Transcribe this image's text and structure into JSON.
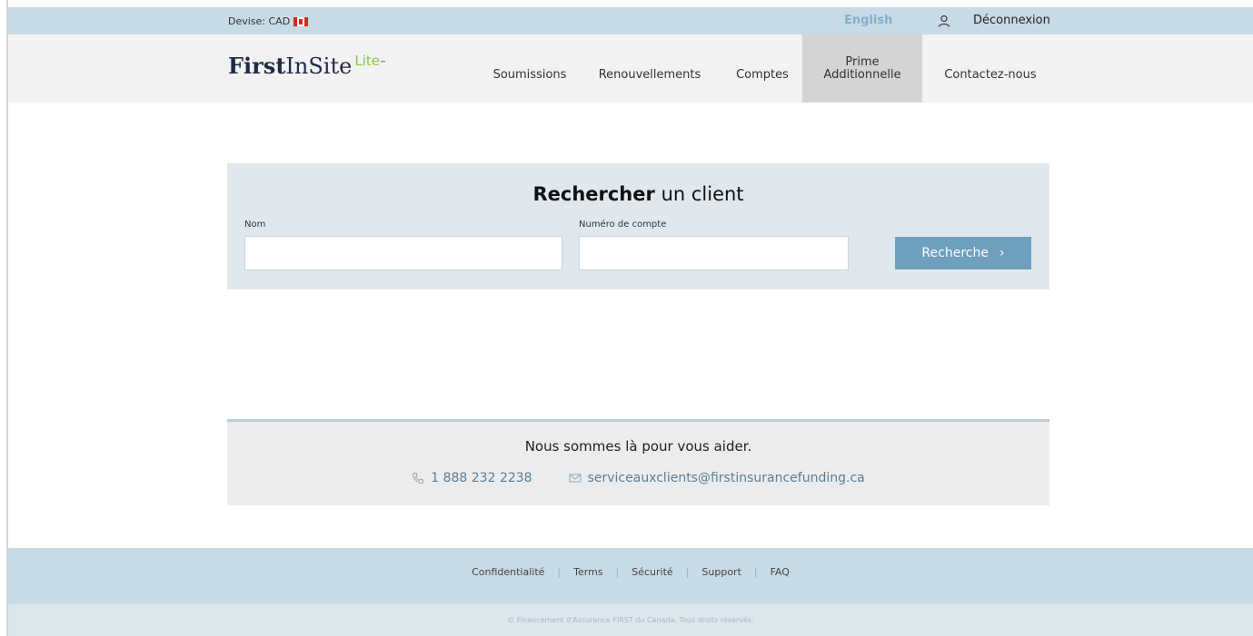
{
  "topbar": {
    "currency": "Devise: CAD",
    "language_link": "English",
    "logout": "Déconnexion"
  },
  "brand": {
    "first": "First",
    "insite": "InSite",
    "lite": "Lite",
    "tm": "™"
  },
  "nav": {
    "items": [
      {
        "label": "Soumissions"
      },
      {
        "label": "Renouvellements"
      },
      {
        "label": "Comptes"
      },
      {
        "label_line1": "Prime",
        "label_line2": "Additionnelle",
        "active": true
      },
      {
        "label": "Contactez-nous"
      }
    ]
  },
  "search": {
    "title_bold": "Rechercher",
    "title_rest": "un client",
    "name_label": "Nom",
    "name_value": "",
    "account_label": "Numéro de compte",
    "account_value": "",
    "button_label": "Recherche",
    "button_arrow": "›"
  },
  "help": {
    "title": "Nous sommes là pour vous aider.",
    "phone": "1 888 232 2238",
    "email": "serviceauxclients@firstinsurancefunding.ca"
  },
  "footer": {
    "links": [
      "Confidentialité",
      "Terms",
      "Sécurité",
      "Support",
      "FAQ"
    ],
    "separator": "|",
    "copyright": "© Financement d'Assurance FIRST du Canada. Tous droits réservés."
  },
  "colors": {
    "topbar_bg": "#c8dae5",
    "accent_button": "#6f9fbf",
    "lite_green": "#8cc63f",
    "link_blue": "#5a7e96"
  },
  "icons": {
    "flag": "canada-flag-icon",
    "user": "user-icon",
    "phone": "phone-icon",
    "email": "envelope-icon",
    "chevron": "chevron-right-icon"
  }
}
